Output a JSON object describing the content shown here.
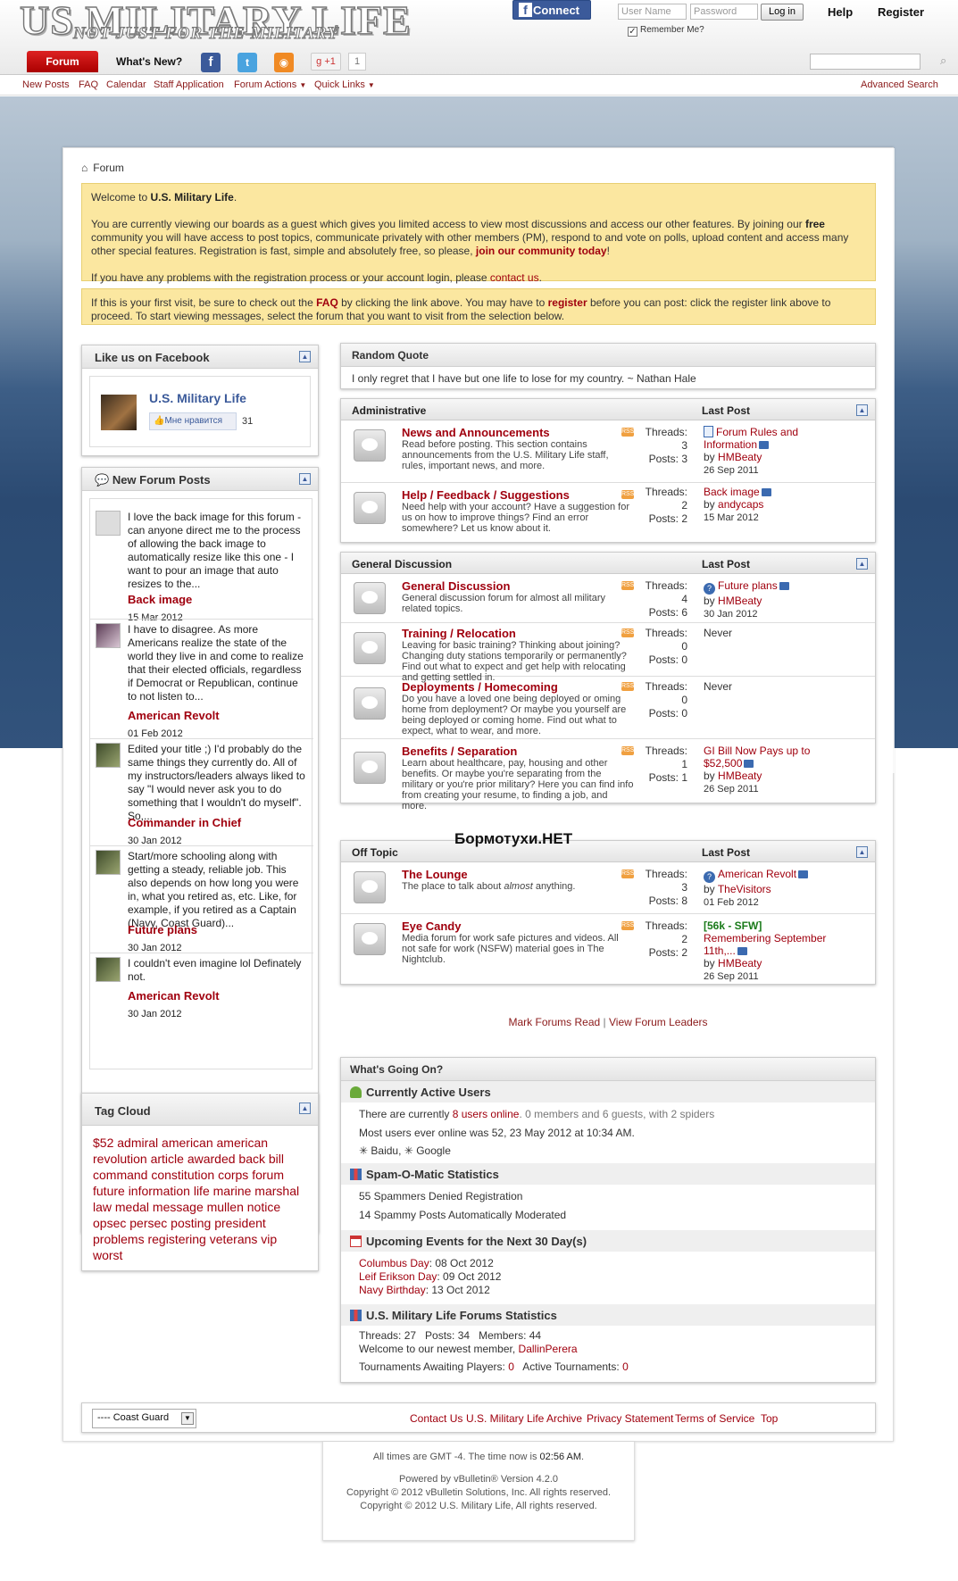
{
  "header": {
    "logo_main": "US MILITARY LIFE",
    "logo_tag": "NOT JUST FOR THE MILITARY",
    "fb_connect": "Connect",
    "username_ph": "User Name",
    "password_ph": "Password",
    "login_btn": "Log in",
    "help": "Help",
    "register": "Register",
    "remember": "Remember Me?"
  },
  "nav": {
    "forum": "Forum",
    "whats_new": "What's New?",
    "gplus": "+1",
    "gcount": "1"
  },
  "subnav": {
    "new_posts": "New Posts",
    "faq": "FAQ",
    "calendar": "Calendar",
    "staff": "Staff Application",
    "forum_actions": "Forum Actions",
    "quick_links": "Quick Links",
    "advanced_search": "Advanced Search"
  },
  "breadcrumb": "Forum",
  "notice1": {
    "welcome_pre": "Welcome to ",
    "welcome_site": "U.S. Military Life",
    "welcome_post": ".",
    "p2a": "You are currently viewing our boards as a guest which gives you limited access to view most discussions and access our other features. By joining our ",
    "p2b": "free",
    "p2c": " community you will have access to post topics, communicate privately with other members (PM), respond to and vote on polls, upload content and access many other special features. Registration is fast, simple and absolutely free, so please, ",
    "p2link": "join our community today",
    "p2d": "!",
    "p3a": "If you have any problems with the registration process or your account login, please ",
    "p3link": "contact us",
    "p3b": "."
  },
  "notice2": {
    "a": "If this is your first visit, be sure to check out the ",
    "faq": "FAQ",
    "b": " by clicking the link above. You may have to ",
    "register": "register",
    "c": " before you can post: click the register link above to proceed. To start viewing messages, select the forum that you want to visit from the selection below."
  },
  "fb_box": {
    "title": "Like us on Facebook",
    "page": "U.S. Military Life",
    "like": "Мне нравится",
    "count": "31"
  },
  "new_posts": {
    "title": "New Forum Posts",
    "items": [
      {
        "text": "I love the back image for this forum - can anyone direct me to the process of allowing the back image to automatically resize like this one - I want to pour an image that auto resizes to the...",
        "title": "Back image",
        "date": "15 Mar 2012"
      },
      {
        "text": "I have to disagree. As more Americans realize the state of the world they live in and come to realize that their elected officials, regardless if Democrat or Republican, continue to not listen to...",
        "title": "American Revolt",
        "date": "01 Feb 2012"
      },
      {
        "text": "Edited your title ;) I'd probably do the same things they currently do. All of my instructors/leaders always liked to say \"I would never ask you to do something that I wouldn't do myself\". So,...",
        "title": "Commander in Chief",
        "date": "30 Jan 2012"
      },
      {
        "text": "Start/more schooling along with getting a steady, reliable job. This also depends on how long you were in, what you retired as, etc. Like, for example, if you retired as a Captain (Navy, Coast Guard)...",
        "title": "Future plans",
        "date": "30 Jan 2012"
      },
      {
        "text": "I couldn't even imagine lol Definately not.",
        "title": "American Revolt",
        "date": "30 Jan 2012"
      }
    ]
  },
  "tag_cloud": {
    "title": "Tag Cloud",
    "tags": "$52 admiral american american revolution article awarded back bill command constitution corps forum future information life marine marshal law medal message mullen notice opsec persec posting president problems registering veterans vip worst"
  },
  "quote": {
    "title": "Random Quote",
    "text": "I only regret that I have but one life to lose for my country. ~ Nathan Hale"
  },
  "labels": {
    "threads": "Threads:",
    "posts": "Posts:",
    "last_post": "Last Post",
    "by": "by"
  },
  "sections": {
    "admin": "Administrative",
    "general": "General Discussion",
    "offtopic": "Off Topic"
  },
  "forums": [
    {
      "title": "News and Announcements",
      "desc": "Read before posting. This section contains announcements from the U.S. Military Life staff, rules, important news, and more.",
      "threads": "3",
      "posts": "3",
      "lp_title": "Forum Rules and Information",
      "lp_by": "HMBeaty",
      "lp_date": "26 Sep 2011"
    },
    {
      "title": "Help / Feedback / Suggestions",
      "desc": "Need help with your account? Have a suggestion for us on how to improve things? Find an error somewhere? Let us know about it.",
      "threads": "2",
      "posts": "2",
      "lp_title": "Back image",
      "lp_by": "andycaps",
      "lp_date": "15 Mar 2012"
    },
    {
      "title": "General Discussion",
      "desc": "General discussion forum for almost all military related topics.",
      "threads": "4",
      "posts": "6",
      "lp_title": "Future plans",
      "lp_by": "HMBeaty",
      "lp_date": "30 Jan 2012"
    },
    {
      "title": "Training / Relocation",
      "desc": "Leaving for basic training? Thinking about joining? Changing duty stations temporarily or permanently? Find out what to expect and get help with relocating and getting settled in.",
      "threads": "0",
      "posts": "0",
      "lp_never": "Never"
    },
    {
      "title": "Deployments / Homecoming",
      "desc": "Do you have a loved one being deployed or oming home from deployment? Or maybe you yourself are being deployed or coming home. Find out what to expect, what to wear, and more.",
      "threads": "0",
      "posts": "0",
      "lp_never": "Never"
    },
    {
      "title": "Benefits / Separation",
      "desc": "Learn about healthcare, pay, housing and other benefits. Or maybe you're separating from the military or you're prior military? Here you can find info from creating your resume, to finding a job, and more.",
      "threads": "1",
      "posts": "1",
      "lp_title": "GI Bill Now Pays up to $52,500",
      "lp_by": "HMBeaty",
      "lp_date": "26 Sep 2011"
    },
    {
      "title": "The Lounge",
      "desc_a": "The place to talk about ",
      "desc_em": "almost",
      "desc_b": " anything.",
      "threads": "3",
      "posts": "8",
      "lp_title": "American Revolt",
      "lp_by": "TheVisitors",
      "lp_date": "01 Feb 2012"
    },
    {
      "title": "Eye Candy",
      "desc": "Media forum for work safe pictures and videos. All not safe for work (NSFW) material goes in The Nightclub.",
      "threads": "2",
      "posts": "2",
      "lp_prefix": "[56k - SFW]",
      "lp_title": "Remembering September 11th,...",
      "lp_by": "HMBeaty",
      "lp_date": "26 Sep 2011"
    }
  ],
  "watermark": "Бормотухи.НЕТ",
  "actions": {
    "mark_read": "Mark Forums Read",
    "leaders": "View Forum Leaders",
    "sep": "|"
  },
  "wgo": {
    "title": "What's Going On?",
    "active_title": "Currently Active Users",
    "active_a": "There are currently ",
    "active_link": "8 users online",
    "active_b": ". 0 members and 6 guests, with 2 spiders",
    "most": "Most users ever online was 52, 23 May 2012 at 10:34 AM.",
    "spider1": "Baidu",
    "spider2": "Google",
    "spam_title": "Spam-O-Matic Statistics",
    "spam1": "55 Spammers Denied Registration",
    "spam2": "14 Spammy Posts Automatically Moderated",
    "events_title": "Upcoming Events for the Next 30 Day(s)",
    "ev1_name": "Columbus Day",
    "ev1_date": ": 08 Oct 2012",
    "ev2_name": "Leif Erikson Day",
    "ev2_date": ": 09 Oct 2012",
    "ev3_name": "Navy Birthday",
    "ev3_date": ": 13 Oct 2012",
    "stats_title": "U.S. Military Life Forums Statistics",
    "stats_line": "Threads: 27   Posts: 34   Members: 44",
    "newest_a": "Welcome to our newest member, ",
    "newest_link": "DallinPerera",
    "tourn_a": "Tournaments Awaiting Players: ",
    "tourn_v1": "0",
    "tourn_b": "   Active Tournaments: ",
    "tourn_v2": "0"
  },
  "footer": {
    "style": "---- Coast Guard",
    "contact": "Contact Us",
    "site": "U.S. Military Life",
    "archive": "Archive",
    "privacy": "Privacy Statement",
    "tos": "Terms of Service",
    "top": "Top"
  },
  "copyright": {
    "time_a": "All times are GMT -4. The time now is ",
    "time_b": "02:56 AM",
    "time_c": ".",
    "l1": "Powered by vBulletin® Version 4.2.0",
    "l2": "Copyright © 2012 vBulletin Solutions, Inc. All rights reserved.",
    "l3": "Copyright © 2012 U.S. Military Life, All rights reserved."
  }
}
